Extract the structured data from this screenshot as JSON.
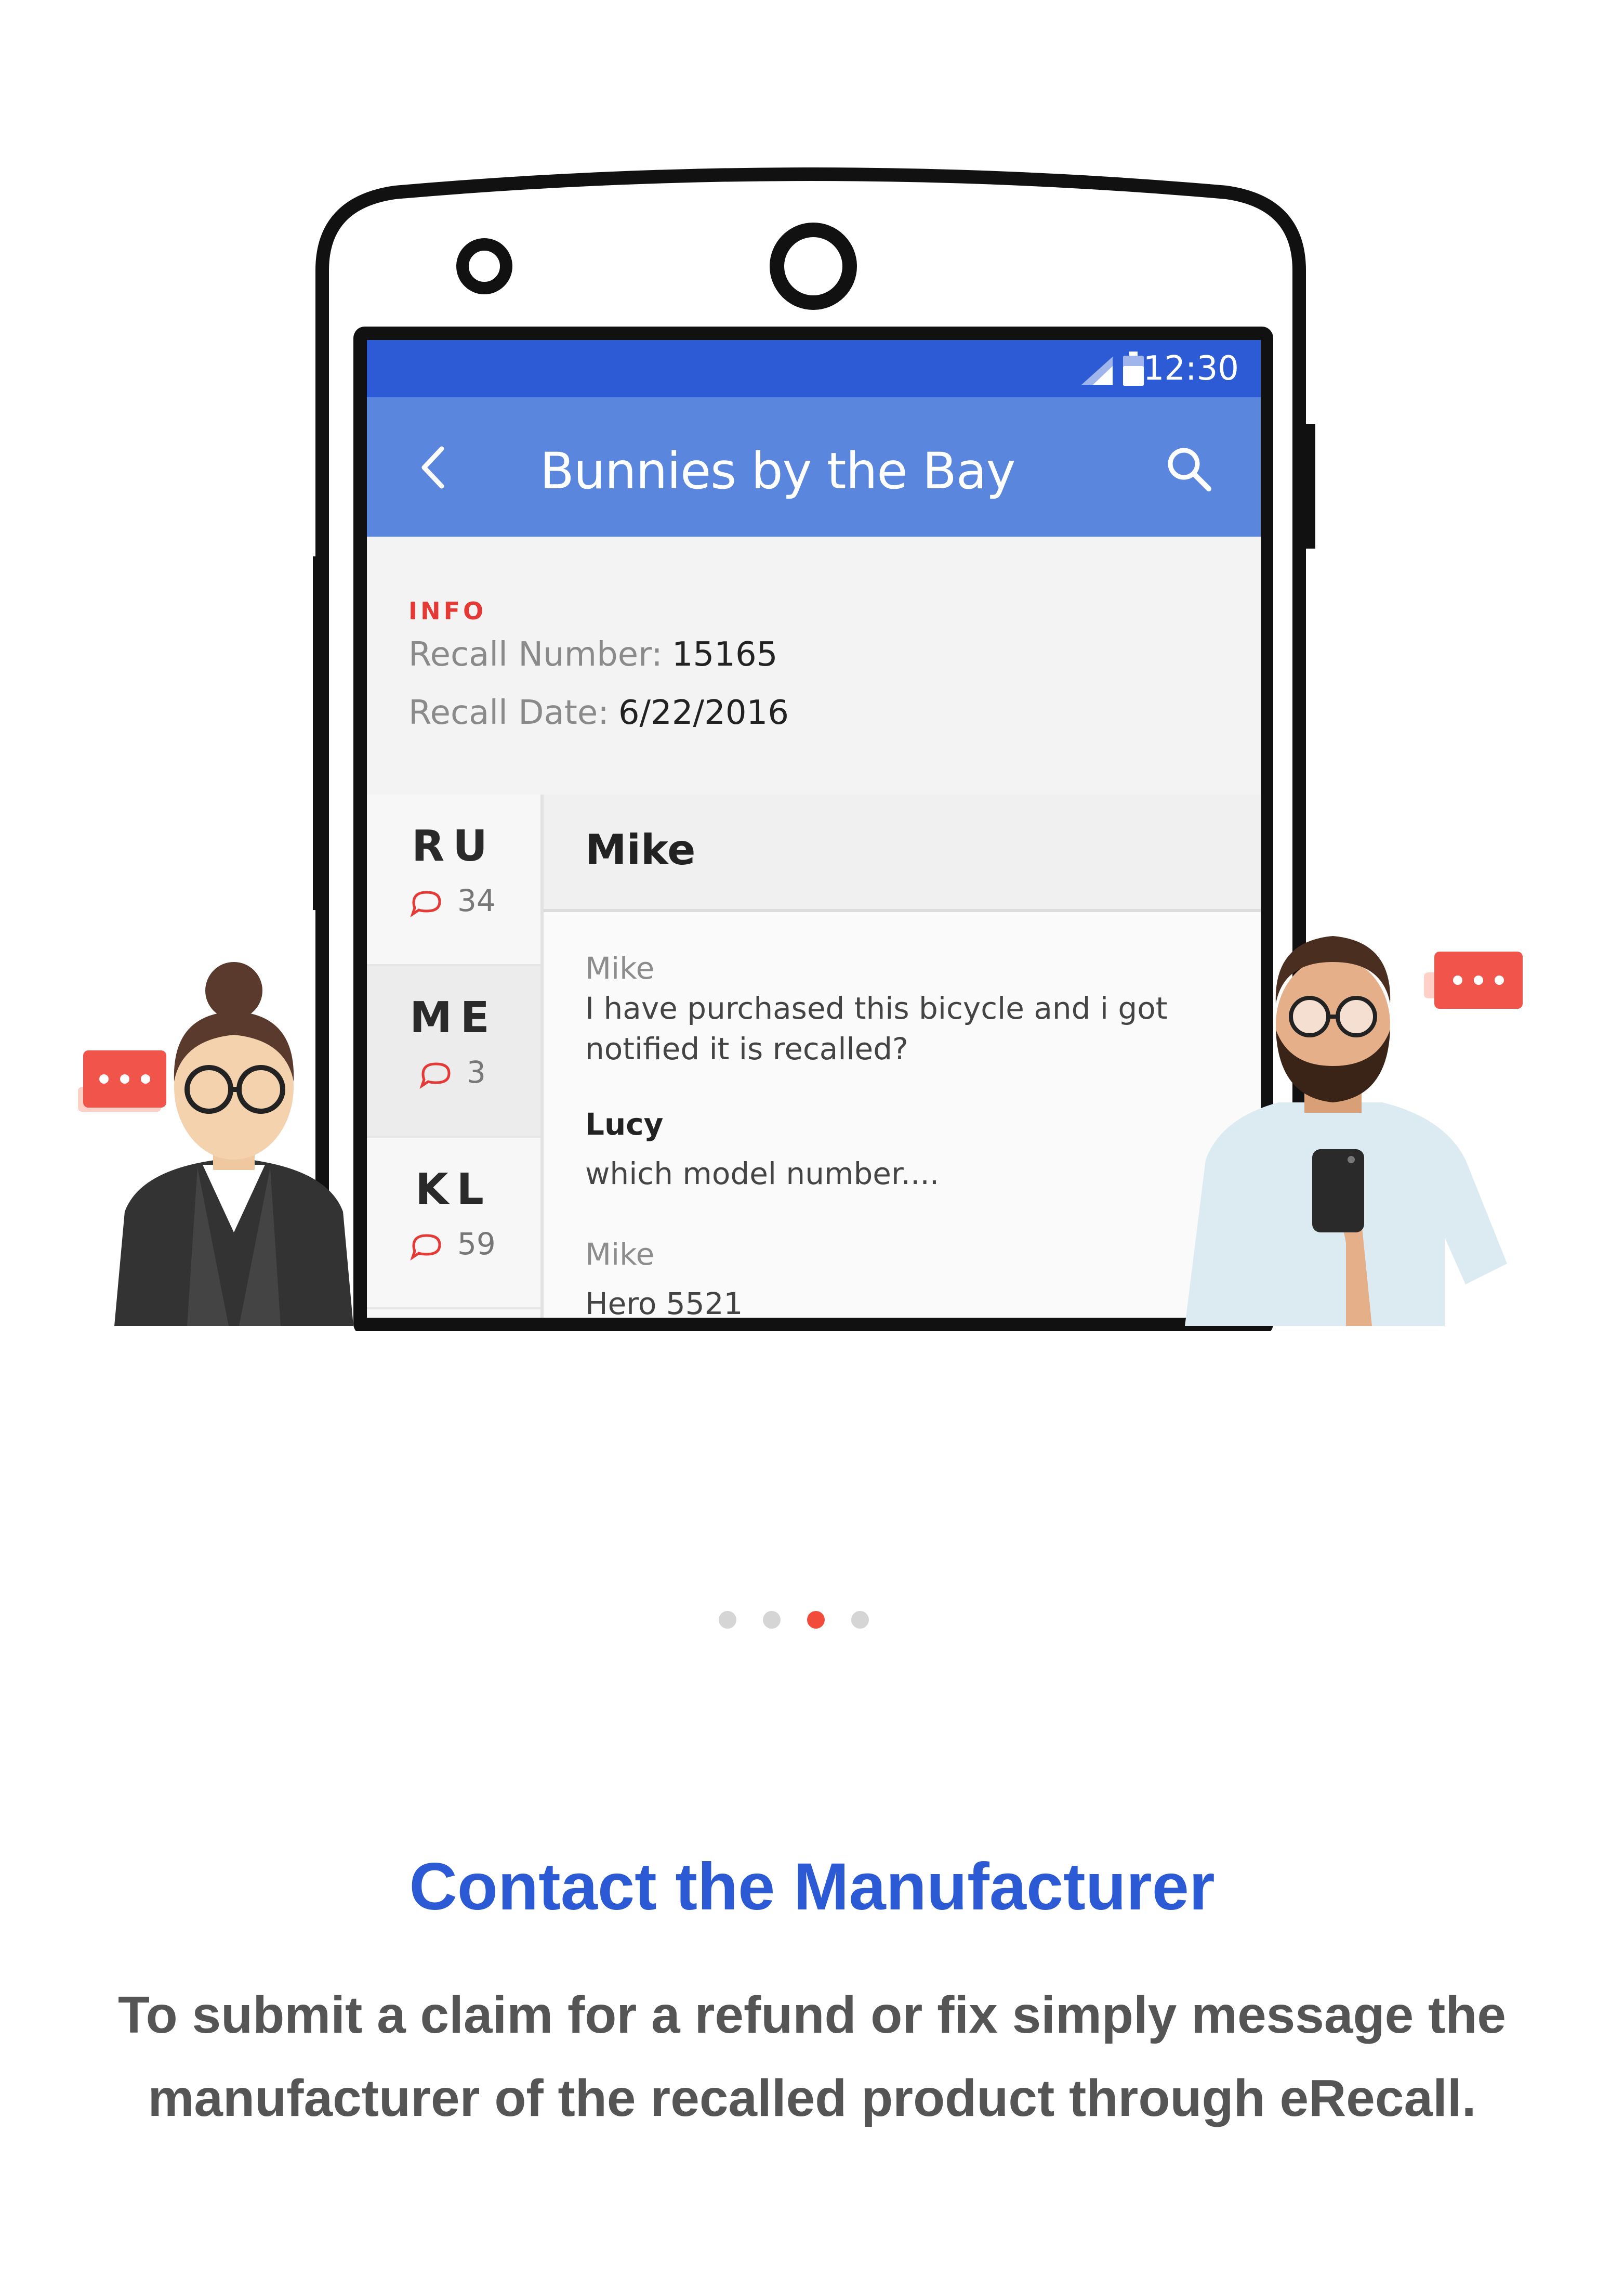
{
  "status_bar": {
    "time": "12:30"
  },
  "app_bar": {
    "title": "Bunnies by the Bay"
  },
  "info": {
    "label": "INFO",
    "recall_number_label": "Recall Number:",
    "recall_number_value": "15165",
    "recall_date_label": "Recall Date:",
    "recall_date_value": "6/22/2016"
  },
  "contacts": [
    {
      "initials": "RU",
      "count": "34",
      "selected": false
    },
    {
      "initials": "ME",
      "count": "3",
      "selected": true
    },
    {
      "initials": "KL",
      "count": "59",
      "selected": false
    }
  ],
  "conversation": {
    "title": "Mike",
    "messages": [
      {
        "sender": "Mike",
        "text": "I have purchased this bicycle and i got notified it is recalled?"
      },
      {
        "sender": "Lucy",
        "text": "which model number...."
      },
      {
        "sender": "Mike",
        "text": "Hero 5521"
      }
    ]
  },
  "pager": {
    "count": 4,
    "active_index": 2
  },
  "heading": "Contact the Manufacturer",
  "description": "To submit a claim for a refund or fix simply message the manufacturer of the recalled product through eRecall.",
  "colors": {
    "brand_blue": "#2b5ad4",
    "status_bar": "#2d5bd6",
    "app_bar": "#5b86de",
    "accent_red": "#f24b3b"
  }
}
